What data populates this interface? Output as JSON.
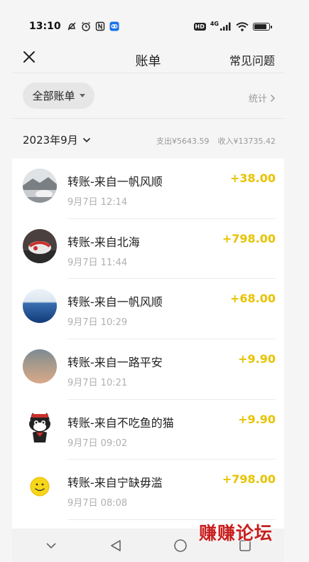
{
  "status_bar": {
    "time": "13:10",
    "network": "4G",
    "hd": "HD"
  },
  "nav": {
    "title": "账单",
    "faq": "常见问题"
  },
  "filter": {
    "label": "全部账单",
    "stats": "统计"
  },
  "summary": {
    "month": "2023年9月",
    "expense": "支出¥5643.59",
    "income": "收入¥13735.42"
  },
  "transactions": [
    {
      "title": "转账-来自一帆风顺",
      "time": "9月7日 12:14",
      "amount": "+38.00"
    },
    {
      "title": "转账-来自北海",
      "time": "9月7日 11:44",
      "amount": "+798.00"
    },
    {
      "title": "转账-来自一帆风顺",
      "time": "9月7日 10:29",
      "amount": "+68.00"
    },
    {
      "title": "转账-来自一路平安",
      "time": "9月7日 10:21",
      "amount": "+9.90"
    },
    {
      "title": "转账-来自不吃鱼的猫",
      "time": "9月7日 09:02",
      "amount": "+9.90"
    },
    {
      "title": "转账-来自宁缺毋滥",
      "time": "9月7日 08:08",
      "amount": "+798.00"
    }
  ],
  "watermark": "赚赚论坛",
  "colors": {
    "amount": "#e8c300",
    "watermark": "#c81e1e"
  }
}
